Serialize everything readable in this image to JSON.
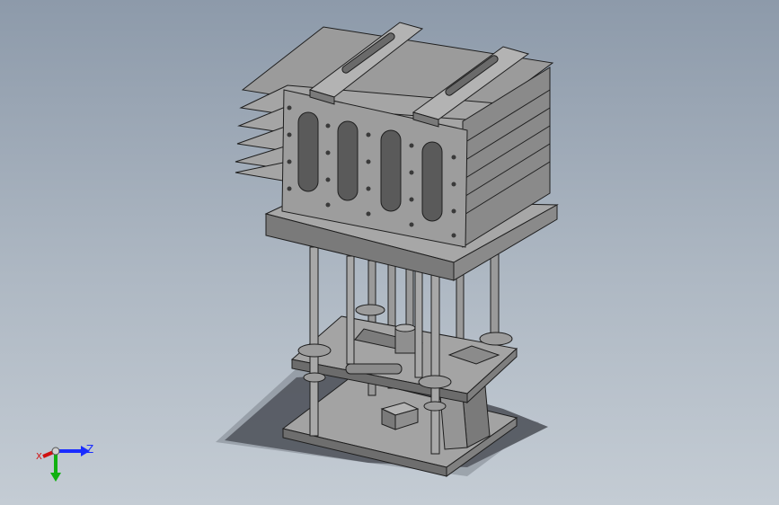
{
  "viewport": {
    "background_top": "#8d9aaa",
    "background_bottom": "#c4ccd4"
  },
  "model": {
    "body_color": "#8e8e8e",
    "edge_color": "#1e1e1e",
    "light_face": "#a6a6a6",
    "dark_face": "#6e6e6e"
  },
  "triad": {
    "x_label": "X",
    "z_label": "Z",
    "x_color": "#d01010",
    "y_color": "#10b010",
    "z_color": "#1a2cff",
    "icon": "coordinate-triad-icon"
  }
}
